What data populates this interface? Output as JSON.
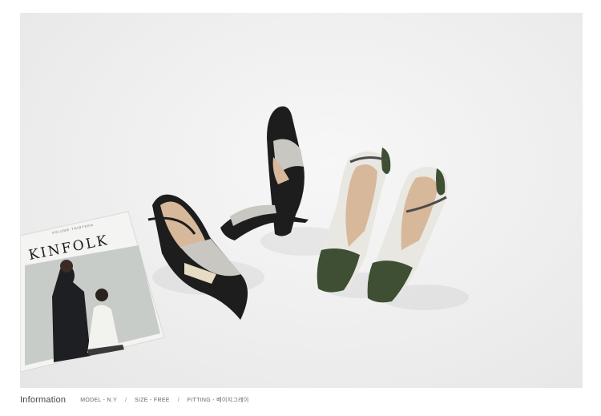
{
  "magazine": {
    "masthead": "KINFOLK",
    "small_line": "VOLUME THIRTEEN"
  },
  "info": {
    "title": "Information",
    "model": "MODEL - N.Y",
    "size": "SIZE - FREE",
    "fitting": "FITTING - 베이지그레이"
  },
  "colors": {
    "black_leather": "#1d1d1d",
    "green_leather": "#3e4f33",
    "beige_lining": "#d8b89a",
    "grey_fabric": "#c9c7c1",
    "cream_panel": "#e6dcc3"
  }
}
